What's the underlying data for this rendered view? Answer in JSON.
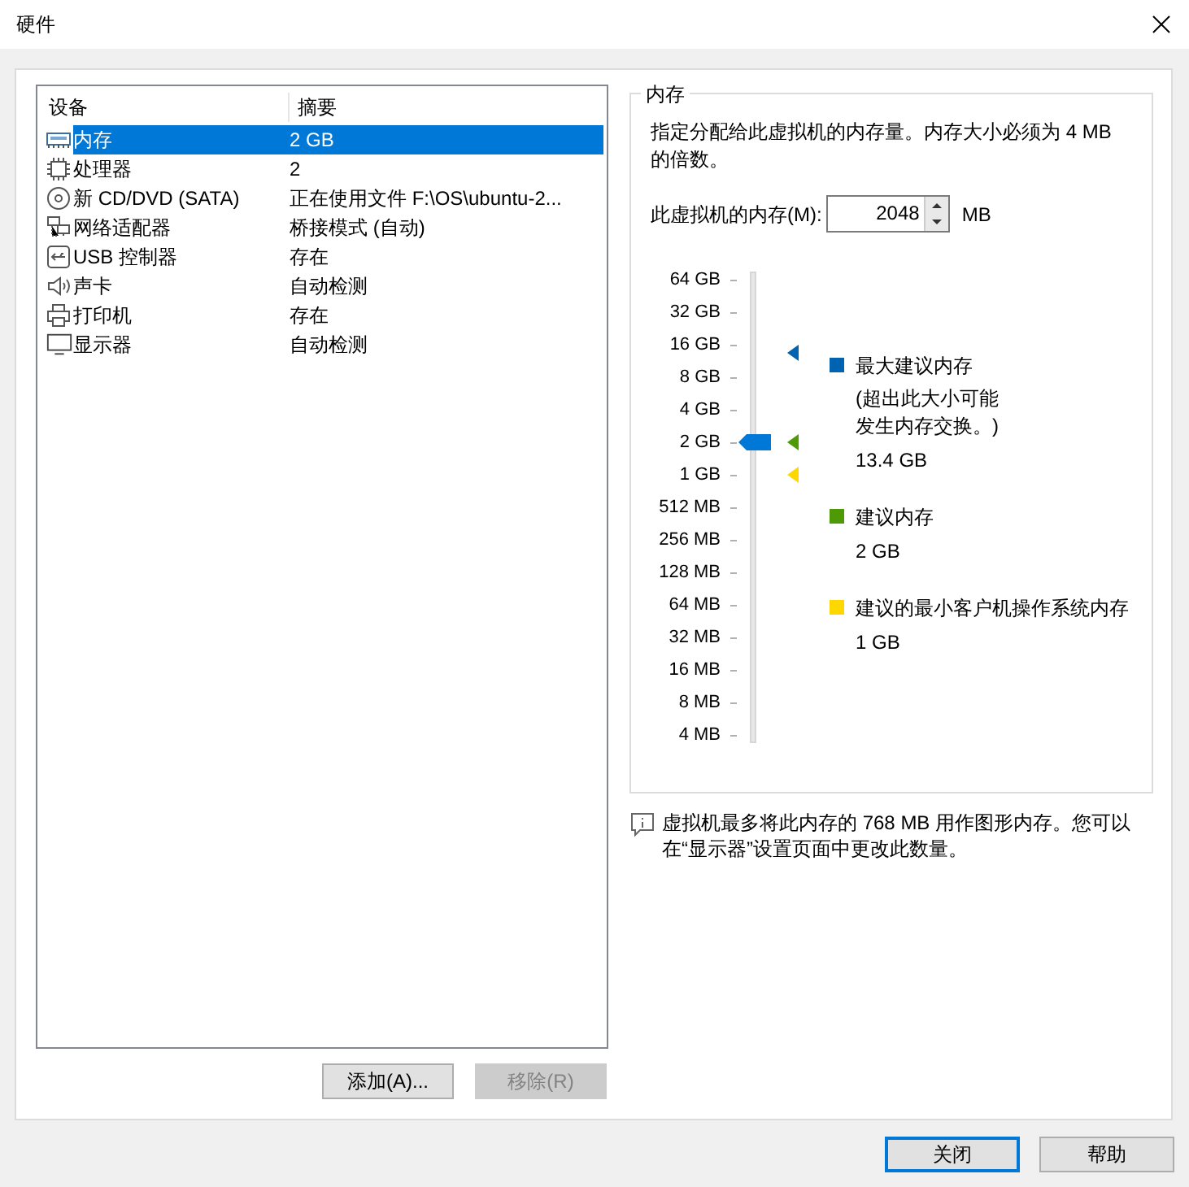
{
  "window": {
    "title": "硬件"
  },
  "devices": {
    "columns": [
      "设备",
      "摘要"
    ],
    "rows": [
      {
        "kind": "memory",
        "name": "内存",
        "summary": "2 GB",
        "selected": true
      },
      {
        "kind": "cpu",
        "name": "处理器",
        "summary": "2",
        "selected": false
      },
      {
        "kind": "cdrom",
        "name": "新 CD/DVD (SATA)",
        "summary": "正在使用文件 F:\\OS\\ubuntu-2...",
        "selected": false
      },
      {
        "kind": "network",
        "name": "网络适配器",
        "summary": "桥接模式 (自动)",
        "selected": false
      },
      {
        "kind": "usb",
        "name": "USB 控制器",
        "summary": "存在",
        "selected": false
      },
      {
        "kind": "sound",
        "name": "声卡",
        "summary": "自动检测",
        "selected": false
      },
      {
        "kind": "printer",
        "name": "打印机",
        "summary": "存在",
        "selected": false
      },
      {
        "kind": "display",
        "name": "显示器",
        "summary": "自动检测",
        "selected": false
      }
    ]
  },
  "device_buttons": [
    {
      "label": "添加(A)...",
      "disabled": false
    },
    {
      "label": "移除(R)",
      "disabled": true
    }
  ],
  "memory": {
    "title": "内存",
    "description": "指定分配给此虚拟机的内存量。内存大小必须为 4 MB 的倍数。",
    "field_label": "此虚拟机的内存(M):",
    "value": "2048",
    "unit": "MB",
    "slider": {
      "ticks": [
        "64 GB",
        "32 GB",
        "16 GB",
        "8 GB",
        "4 GB",
        "2 GB",
        "1 GB",
        "512 MB",
        "256 MB",
        "128 MB",
        "64 MB",
        "32 MB",
        "16 MB",
        "8 MB",
        "4 MB"
      ],
      "level": 0.643,
      "markers": [
        {
          "color": "#0063b1",
          "level": 0.839
        },
        {
          "color": "#4e9a06",
          "level": 0.643
        },
        {
          "color": "#ffd700",
          "level": 0.571
        }
      ]
    },
    "legend": [
      {
        "color": "#0063b1",
        "title": "最大建议内存",
        "note": "(超出此大小可能发生内存交换。)",
        "value": "13.4 GB"
      },
      {
        "color": "#4e9a06",
        "title": "建议内存",
        "value": "2 GB"
      },
      {
        "color": "#ffd700",
        "title": "建议的最小客户机操作系统内存",
        "value": "1 GB"
      }
    ]
  },
  "info": "虚拟机最多将此内存的 768 MB 用作图形内存。您可以在“显示器”设置页面中更改此数量。",
  "buttons": [
    "关闭",
    "帮助"
  ]
}
